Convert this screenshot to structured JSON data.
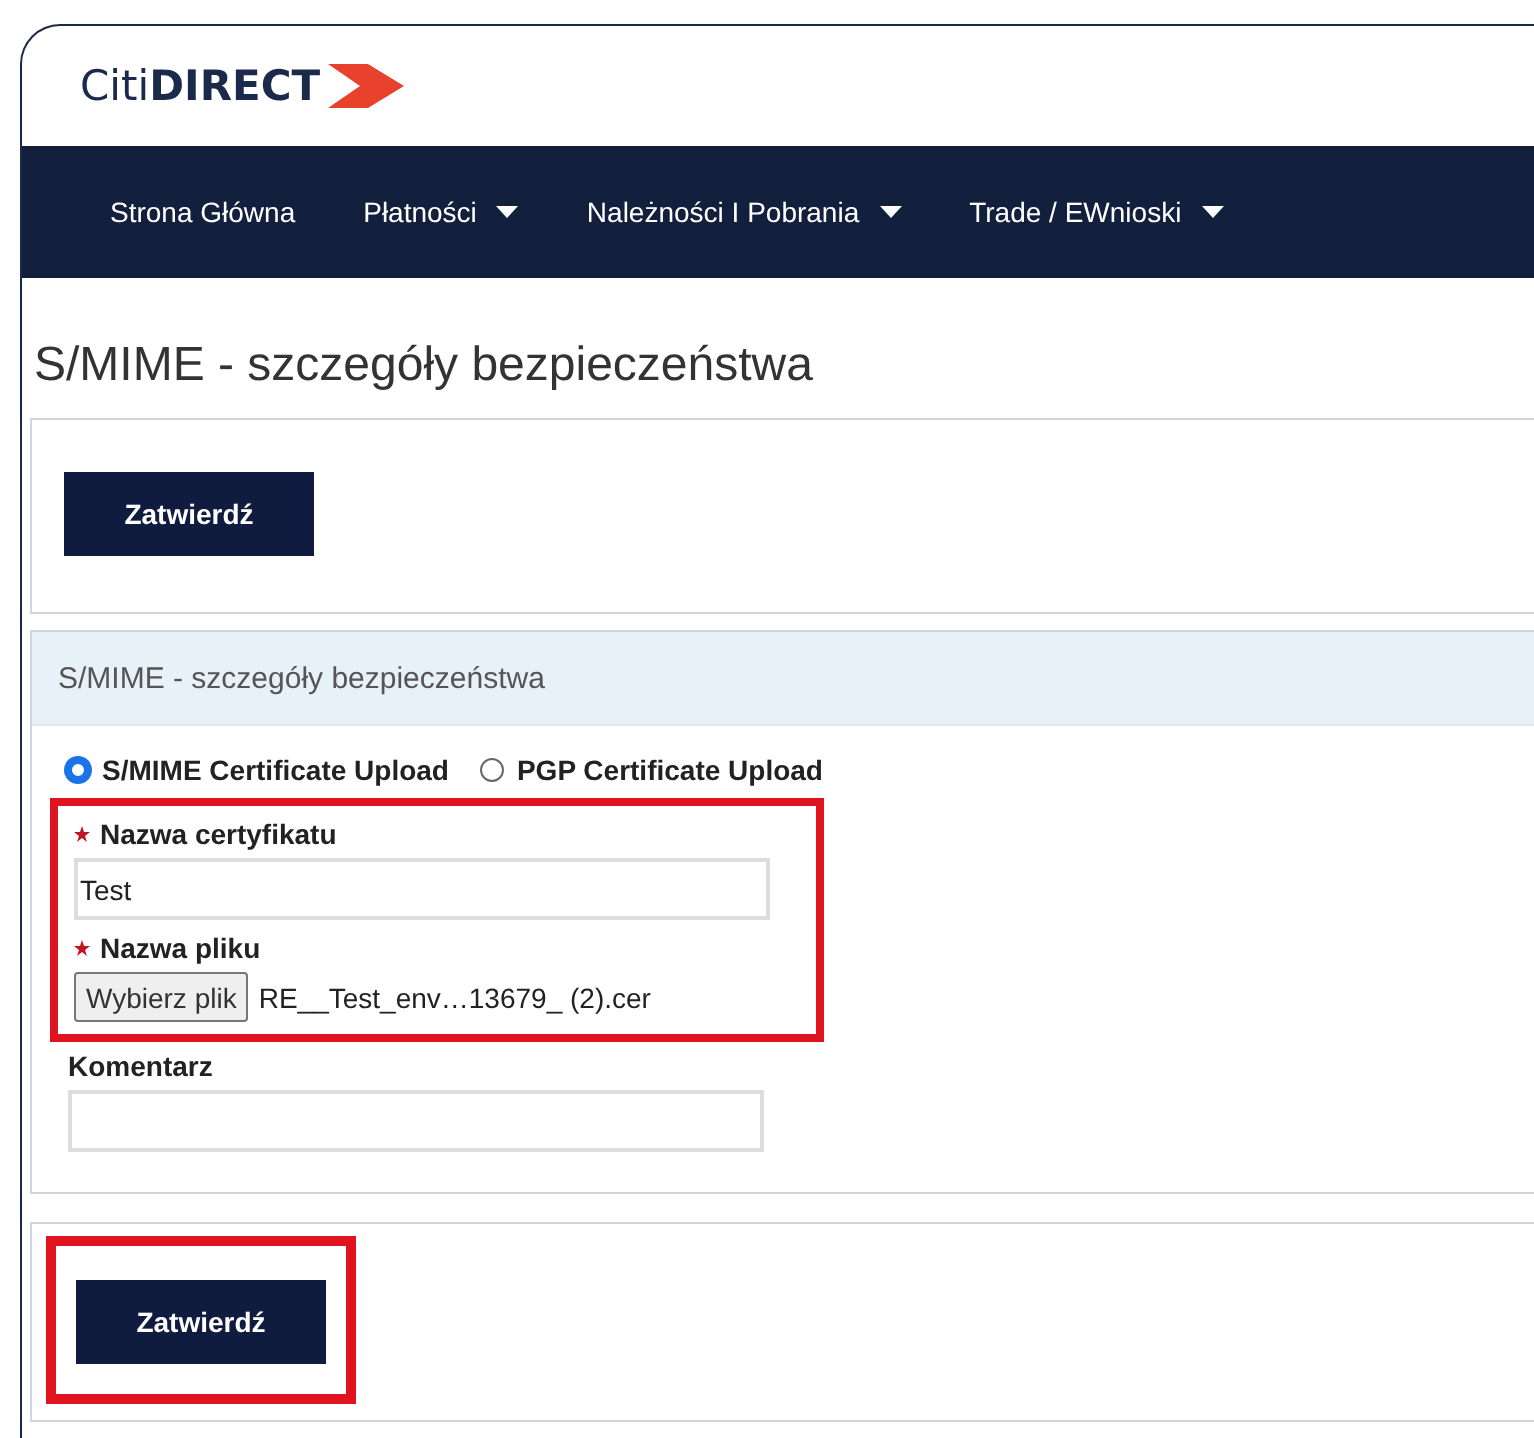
{
  "logo": {
    "light": "Citi",
    "bold": "DIRECT"
  },
  "nav": [
    {
      "label": "Strona Główna",
      "dropdown": false
    },
    {
      "label": "Płatności",
      "dropdown": true
    },
    {
      "label": "Należności I Pobrania",
      "dropdown": true
    },
    {
      "label": "Trade / EWnioski",
      "dropdown": true
    }
  ],
  "page_title": "S/MIME - szczegóły bezpieczeństwa",
  "top_button": "Zatwierdź",
  "section_title": "S/MIME - szczegóły bezpieczeństwa",
  "upload_types": [
    {
      "label": "S/MIME Certificate Upload",
      "selected": true
    },
    {
      "label": "PGP Certificate Upload",
      "selected": false
    }
  ],
  "required_group": {
    "highlighted": true,
    "certificate_name": {
      "label": "Nazwa certyfikatu",
      "required": true,
      "value": "Test"
    },
    "file": {
      "label": "Nazwa pliku",
      "required": true,
      "button": "Wybierz plik",
      "file_name": "RE__Test_env…13679_ (2).cer"
    }
  },
  "comment": {
    "label": "Komentarz",
    "required": false
  },
  "bottom_button": {
    "label": "Zatwierdź",
    "highlighted": true
  }
}
